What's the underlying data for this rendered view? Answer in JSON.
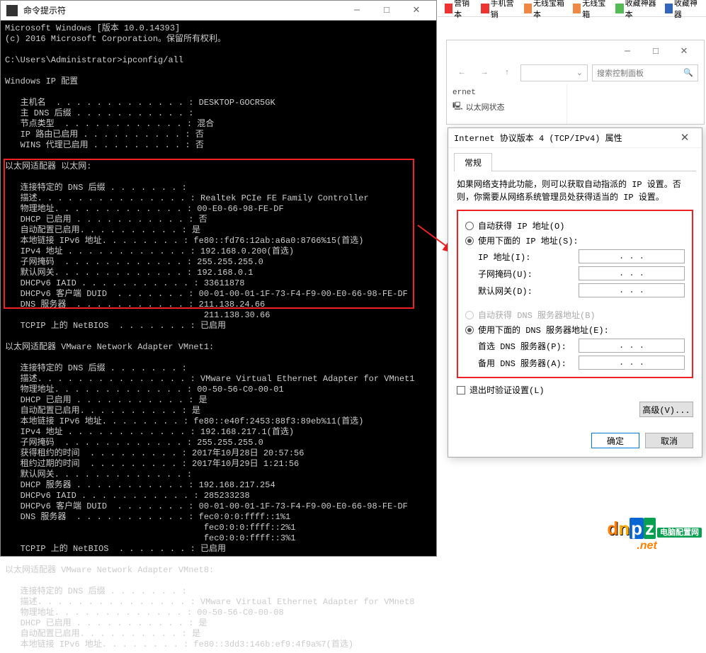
{
  "terminal": {
    "title": "命令提示符",
    "content": "Microsoft Windows [版本 10.0.14393]\n(c) 2016 Microsoft Corporation。保留所有权利。\n\nC:\\Users\\Administrator>ipconfig/all\n\nWindows IP 配置\n\n   主机名  . . . . . . . . . . . . . : DESKTOP-GOCR5GK\n   主 DNS 后缀 . . . . . . . . . . . :\n   节点类型  . . . . . . . . . . . . : 混合\n   IP 路由已启用 . . . . . . . . . . : 否\n   WINS 代理已启用 . . . . . . . . . : 否\n\n以太网适配器 以太网:\n\n   连接特定的 DNS 后缀 . . . . . . . :\n   描述. . . . . . . . . . . . . . . : Realtek PCIe FE Family Controller\n   物理地址. . . . . . . . . . . . . : 00-E0-66-98-FE-DF\n   DHCP 已启用 . . . . . . . . . . . : 否\n   自动配置已启用. . . . . . . . . . : 是\n   本地链接 IPv6 地址. . . . . . . . : fe80::fd76:12ab:a6a0:8766%15(首选)\n   IPv4 地址 . . . . . . . . . . . . : 192.168.0.200(首选)\n   子网掩码  . . . . . . . . . . . . : 255.255.255.0\n   默认网关. . . . . . . . . . . . . : 192.168.0.1\n   DHCPv6 IAID . . . . . . . . . . . : 33611878\n   DHCPv6 客户端 DUID  . . . . . . . : 00-01-00-01-1F-73-F4-F9-00-E0-66-98-FE-DF\n   DNS 服务器  . . . . . . . . . . . : 211.138.24.66\n                                       211.138.30.66\n   TCPIP 上的 NetBIOS  . . . . . . . : 已启用\n\n以太网适配器 VMware Network Adapter VMnet1:\n\n   连接特定的 DNS 后缀 . . . . . . . :\n   描述. . . . . . . . . . . . . . . : VMware Virtual Ethernet Adapter for VMnet1\n   物理地址. . . . . . . . . . . . . : 00-50-56-C0-00-01\n   DHCP 已启用 . . . . . . . . . . . : 是\n   自动配置已启用. . . . . . . . . . : 是\n   本地链接 IPv6 地址. . . . . . . . : fe80::e40f:2453:88f3:89eb%11(首选)\n   IPv4 地址 . . . . . . . . . . . . : 192.168.217.1(首选)\n   子网掩码  . . . . . . . . . . . . : 255.255.255.0\n   获得租约的时间  . . . . . . . . . : 2017年10月28日 20:57:56\n   租约过期的时间  . . . . . . . . . : 2017年10月29日 1:21:56\n   默认网关. . . . . . . . . . . . . :\n   DHCP 服务器 . . . . . . . . . . . : 192.168.217.254\n   DHCPv6 IAID . . . . . . . . . . . : 285233238\n   DHCPv6 客户端 DUID  . . . . . . . : 00-01-00-01-1F-73-F4-F9-00-E0-66-98-FE-DF\n   DNS 服务器  . . . . . . . . . . . : fec0:0:0:ffff::1%1\n                                       fec0:0:0:ffff::2%1\n                                       fec0:0:0:ffff::3%1\n   TCPIP 上的 NetBIOS  . . . . . . . : 已启用\n\n以太网适配器 VMware Network Adapter VMnet8:\n\n   连接特定的 DNS 后缀 . . . . . . . :\n   描述. . . . . . . . . . . . . . . : VMware Virtual Ethernet Adapter for VMnet8\n   物理地址. . . . . . . . . . . . . : 00-50-56-C0-00-08\n   DHCP 已启用 . . . . . . . . . . . : 是\n   自动配置已启用. . . . . . . . . . : 是\n   本地链接 IPv6 地址. . . . . . . . : fe80::3dd3:146b:ef9:4f9a%7(首选)"
  },
  "toolbar": {
    "items": [
      "营销本",
      "手机营销",
      "无线宝箱本",
      "无线宝箱",
      "收藏神器本",
      "收藏神器"
    ],
    "colors": [
      "#e33",
      "#e33",
      "#e84",
      "#e84",
      "#5b5",
      "#36b"
    ]
  },
  "explorer": {
    "search_placeholder": "搜索控制面板",
    "side1": "ernet",
    "side2": "以太网状态"
  },
  "dialog": {
    "title": "Internet 协议版本 4 (TCP/IPv4) 属性",
    "tab": "常规",
    "description": "如果网络支持此功能，则可以获取自动指派的 IP 设置。否则，你需要从网络系统管理员处获得适当的 IP 设置。",
    "auto_ip": "自动获得 IP 地址(O)",
    "manual_ip": "使用下面的 IP 地址(S):",
    "ip_label": "IP 地址(I):",
    "mask_label": "子网掩码(U):",
    "gateway_label": "默认网关(D):",
    "auto_dns": "自动获得 DNS 服务器地址(B)",
    "manual_dns": "使用下面的 DNS 服务器地址(E):",
    "dns1_label": "首选 DNS 服务器(P):",
    "dns2_label": "备用 DNS 服务器(A):",
    "validate": "退出时验证设置(L)",
    "advanced": "高级(V)...",
    "ok": "确定",
    "cancel": "取消",
    "ip_placeholder": ".        .        ."
  },
  "logo": {
    "tag": "电脑配置网",
    "net": ".net"
  }
}
